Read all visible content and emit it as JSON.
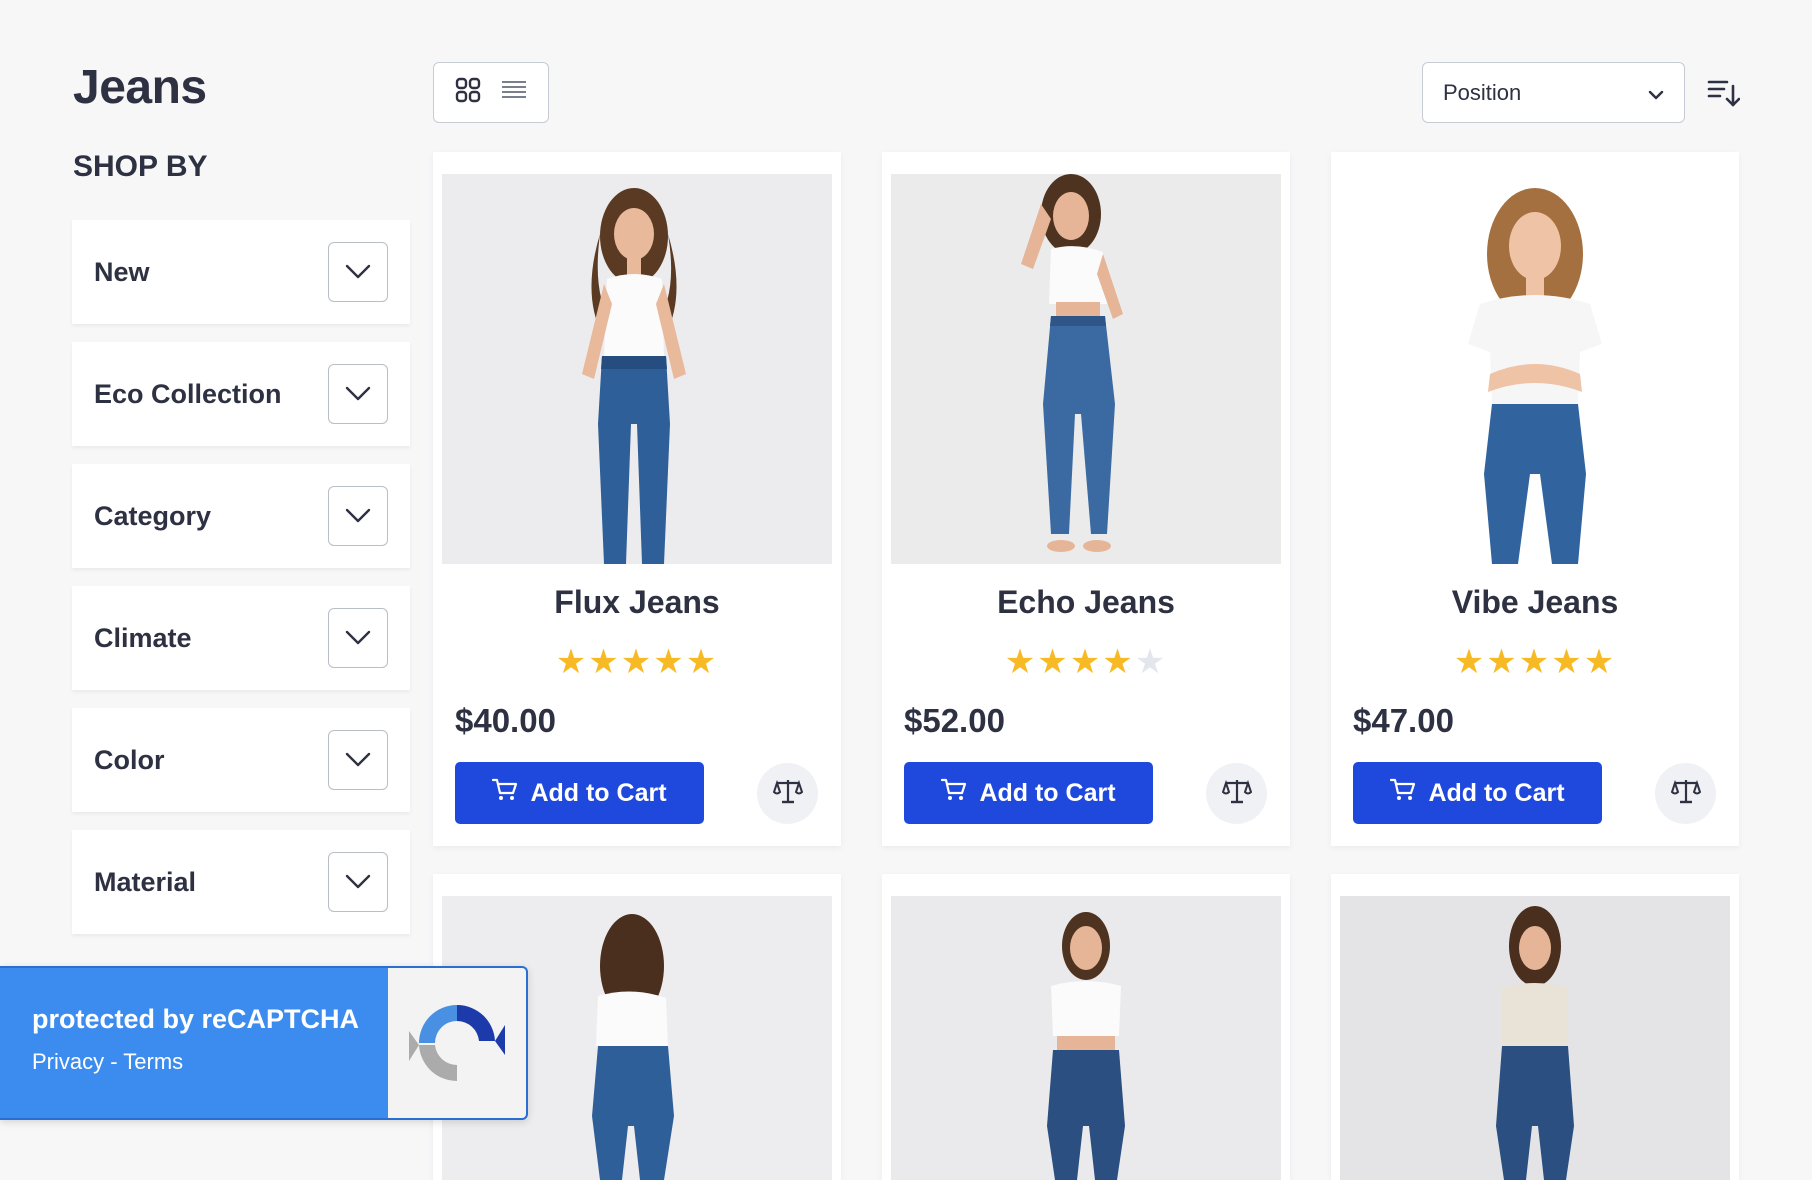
{
  "page": {
    "title": "Jeans"
  },
  "sidebar": {
    "heading": "SHOP BY",
    "filters": [
      {
        "label": "New"
      },
      {
        "label": "Eco Collection"
      },
      {
        "label": "Category"
      },
      {
        "label": "Climate"
      },
      {
        "label": "Color"
      },
      {
        "label": "Material"
      }
    ]
  },
  "toolbar": {
    "view_modes": [
      "grid-view-icon",
      "list-view-icon"
    ],
    "sort": {
      "selected": "Position"
    }
  },
  "products": [
    {
      "name": "Flux Jeans",
      "rating": 5,
      "price": "$40.00",
      "cart_label": "Add to Cart"
    },
    {
      "name": "Echo Jeans",
      "rating": 4,
      "price": "$52.00",
      "cart_label": "Add to Cart"
    },
    {
      "name": "Vibe Jeans",
      "rating": 5,
      "price": "$47.00",
      "cart_label": "Add to Cart"
    }
  ],
  "recaptcha": {
    "title": "protected by reCAPTCHA",
    "links": "Privacy - Terms"
  },
  "colors": {
    "accent": "#1f48dc",
    "star": "#f7b924",
    "recaptcha_bg": "#3b8cee"
  }
}
